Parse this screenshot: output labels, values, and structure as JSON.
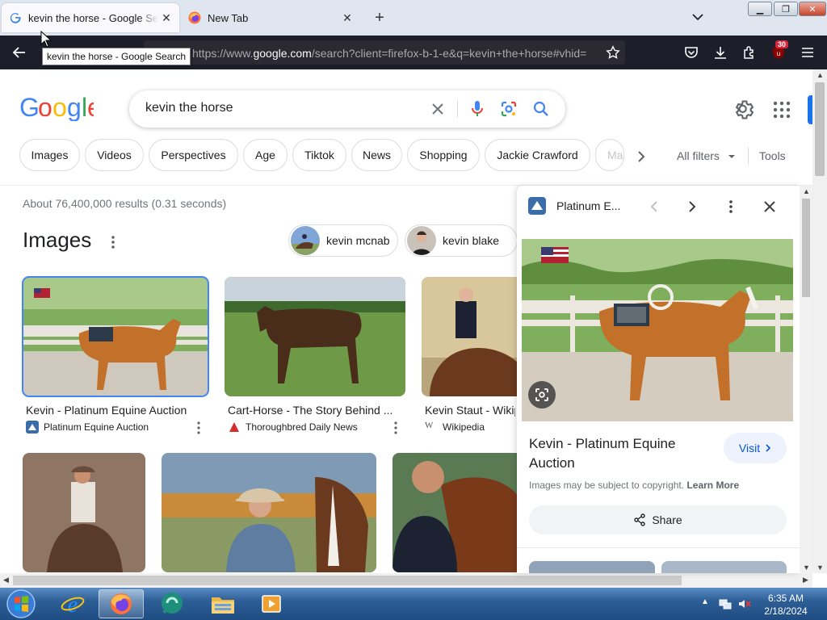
{
  "browser": {
    "tabs": [
      {
        "title": "kevin the horse - Google Search",
        "active": true
      },
      {
        "title": "New Tab",
        "active": false
      }
    ],
    "tooltip": "kevin the horse - Google Search",
    "url_prefix": "https://www.",
    "url_domain": "google.com",
    "url_rest": "/search?client=firefox-b-1-e&q=kevin+the+horse#vhid=",
    "badge_count": "30"
  },
  "search": {
    "query": "kevin the horse",
    "chips": [
      "Images",
      "Videos",
      "Perspectives",
      "Age",
      "Tiktok",
      "News",
      "Shopping",
      "Jackie Crawford",
      "Ma"
    ],
    "all_filters": "All filters",
    "tools": "Tools",
    "stats": "About 76,400,000 results (0.31 seconds)"
  },
  "images_section": {
    "heading": "Images",
    "people": [
      {
        "name": "kevin mcnab"
      },
      {
        "name": "kevin blake"
      }
    ],
    "results": [
      {
        "caption": "Kevin - Platinum Equine Auction",
        "source": "Platinum Equine Auction"
      },
      {
        "caption": "Cart-Horse - The Story Behind ...",
        "source": "Thoroughbred Daily News"
      },
      {
        "caption": "Kevin Staut - Wikipedia",
        "source": "Wikipedia"
      }
    ]
  },
  "panel": {
    "site": "Platinum E...",
    "title": "Kevin - Platinum Equine Auction",
    "visit_label": "Visit",
    "copyright_text": "Images may be subject to copyright.",
    "learn_more": "Learn More",
    "share_label": "Share"
  },
  "taskbar": {
    "time": "6:35 AM",
    "date": "2/18/2024"
  },
  "colors": {
    "google_blue": "#4285F4",
    "google_red": "#EA4335",
    "google_yellow": "#FBBC05",
    "google_green": "#34A853",
    "firefox_toolbar": "#1E1E2A"
  }
}
